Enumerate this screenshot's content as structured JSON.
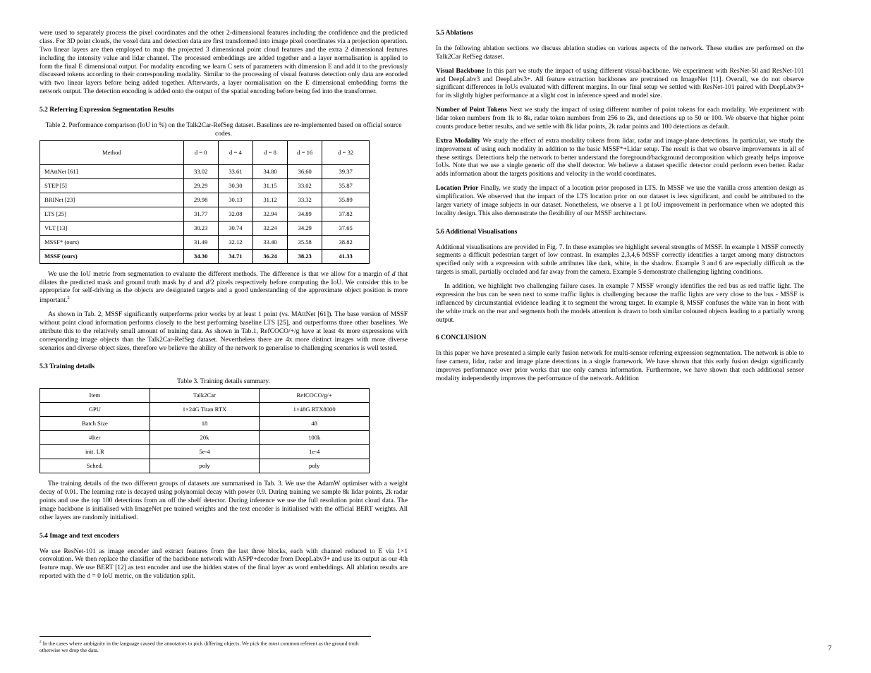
{
  "leftcol": {
    "para1": "were used to separately process the pixel coordinates and the other 2-dimensional features including the confidence and the predicted class. For 3D point clouds, the voxel data and detection data are first transformed into image pixel coordinates via a projection operation. Two linear layers are then employed to map the projected 3 dimensional point cloud features and the extra 2 dimensional features including the intensity value and lidar channel. The processed embeddings are added together and a layer normalisation is applied to form the final E dimensional output. For modality encoding we learn C sets of parameters with dimension E and add it to the previously discussed tokens according to their corresponding modality. Similar to the processing of visual features detection only data are encoded with two linear layers before being added together. Afterwards, a layer normalisation on the E dimensional embedding forms the network output. The detection encoding is added onto the output of the spatial encoding before being fed into the transformer.",
    "sectionRef": "5.2  Referring Expression Segmentation Results",
    "table2": {
      "caption": "Table 2. Performance comparison (IoU in %) on the Talk2Car-RefSeg dataset. Baselines are re-implemented based on official source codes.",
      "headers": [
        "Method",
        "d = 0",
        "d = 4",
        "d = 8",
        "d = 16",
        "d = 32"
      ],
      "rows": [
        {
          "label": "MAttNet [61]",
          "vals": [
            "33.02",
            "33.61",
            "34.80",
            "36.60",
            "39.37"
          ]
        },
        {
          "label": "STEP [5]",
          "vals": [
            "29.29",
            "30.30",
            "31.15",
            "33.02",
            "35.87"
          ]
        },
        {
          "label": "BRINet [23]",
          "vals": [
            "29.98",
            "30.13",
            "31.12",
            "33.32",
            "35.89"
          ]
        },
        {
          "label": "LTS [25]",
          "vals": [
            "31.77",
            "32.08",
            "32.94",
            "34.89",
            "37.82"
          ]
        },
        {
          "label": "VLT [13]",
          "vals": [
            "30.23",
            "30.74",
            "32.24",
            "34.29",
            "37.65"
          ]
        },
        {
          "label": "MSSF* (ours)",
          "vals": [
            "31.49",
            "32.12",
            "33.40",
            "35.58",
            "38.82"
          ]
        },
        {
          "label": "MSSF (ours)",
          "vals": [
            "34.30",
            "34.71",
            "36.24",
            "38.23",
            "41.33"
          ]
        }
      ]
    },
    "para2a": "We use the IoU metric from segmentation to evaluate the different methods. The difference is that we allow for a margin of ",
    "para2b": " that dilates the predicted mask and ground truth mask by ",
    "para2c": " and ",
    "para2d": " pixels respectively before computing the IoU. We consider this to be appropriate for self-driving as the objects are designated targets and a good understanding of the approximate object position is more important.",
    "para3": "As shown in Tab. 2, MSSF significantly outperforms prior works by at least 1 point (vs. MAttNet [61]). The base version of MSSF without point cloud information performs closely to the best performing baseline LTS [25], and outperforms three other baselines. We attribute this to the relatively small amount of training data. As shown in Tab.1, RefCOCO/+/g have at least 4x more expressions with corresponding image objects than the Talk2Car-RefSeg dataset. Nevertheless there are 4x more distinct images with more diverse scenarios and diverse object sizes, therefore we believe the ability of the network to generalise to challenging scenarios is well tested.",
    "sectionTraining": "5.3  Training details",
    "table3": {
      "caption": "Table 3. Training details summary.",
      "headers": [
        "Item",
        "Talk2Car",
        "RefCOCO/g/+"
      ],
      "rows": [
        {
          "c0": "GPU",
          "c1": "1×24G Titan RTX",
          "c2": "1×48G RTX8000"
        },
        {
          "c0": "Batch Size",
          "c1": "18",
          "c2": "48"
        },
        {
          "c0": "#Iter",
          "c1": "20k",
          "c2": "100k"
        },
        {
          "c0": "init. LR",
          "c1": "5e-4",
          "c2": "1e-4"
        },
        {
          "c0": "Sched.",
          "c1": "poly",
          "c2": "poly"
        }
      ]
    },
    "para4": "The training details of the two different groups of datasets are summarised in Tab. 3. We use the AdamW optimiser with a weight decay of 0.01. The learning rate is decayed using polynomial decay with power 0.9. During training we sample 8k lidar points, 2k radar points and use the top 100 detections from an off the shelf detector. During inference we use the full resolution point cloud data. The image backbone is initialised with ImageNet pre trained weights and the text encoder is initialised with the official BERT weights. All other layers are randomly initialised.",
    "sectionEncoders": "5.4  Image and text encoders",
    "para5": "We use ResNet-101 as image encoder and extract features from the last three blocks, each with channel reduced to E via 1×1 convolution. We then replace the classifier of the backbone network with ASPP+decoder from DeepLabv3+ and use its output as our 4th feature map. We use BERT [12] as text encoder and use the hidden states of the final layer as word embeddings. All ablation results are reported with the d = 0 IoU metric, on the validation split.",
    "footnote": {
      "marker": "2",
      "body": "In the cases where ambiguity in the language caused the annotators to pick differing objects. We pick the most common referent as the ground truth otherwise we drop the data."
    }
  },
  "rightcol": {
    "sectionAbl": "5.5  Ablations",
    "ablPara": "In the following ablation sections we discuss ablation studies on various aspects of the network. These studies are performed on the Talk2Car RefSeg dataset.",
    "ablBackboneTitle": "Visual Backbone",
    "ablBackboneBody": "  In this part we study the impact of using different visual-backbone. We experiment with ResNet-50 and ResNet-101 and DeepLabv3 and DeepLabv3+. All feature extraction backbones are pretrained on ImageNet [11]. Overall, we do not observe significant differences in IoUs evaluated with different margins. In our final setup we settled with ResNet-101 paired with DeepLabv3+ for its slightly higher performance at a slight cost in inference speed and model size.",
    "ablPointsTitle": "Number of Point Tokens",
    "ablPointsBody": "  Next we study the impact of using different number of point tokens for each modality. We experiment with lidar token numbers from 1k to 8k, radar token numbers from 256 to 2k, and detections up to 50 or 100. We observe that higher point counts produce better results, and we settle with 8k lidar points, 2k radar points and 100 detections as default.",
    "ablExtraTitle": "Extra Modality",
    "ablExtraBody": "  We study the effect of extra modality tokens from lidar, radar and image-plane detections. In particular, we study the improvement of using each modality in addition to the basic MSSF*+Lidar setup. The result is that we observe improvements in all of these settings. Detections help the network to better understand the foreground/background decomposition which greatly helps improve IoUs. Note that we use a single generic off the shelf detector. We believe a dataset specific detector could perform even better. Radar adds information about the targets positions and velocity in the world coordinates.",
    "ablLocTitle": "Location Prior",
    "ablLocBody": "  Finally, we study the impact of a location prior proposed in LTS. In MSSF we use the vanilla cross attention design as simplification. We observed that the impact of the LTS location prior on our dataset is less significant, and could be attributed to the larger variety of image subjects in our dataset. Nonetheless, we observe a 1 pt IoU improvement in performance when we adopted this locality design. This also demonstrate the flexibility of our MSSF architecture.",
    "sectionAddtlTitle": "5.6  Additional Visualisations",
    "addtl1": "Additional visualisations are provided in Fig. 7. In these examples we highlight several strengths of MSSF. In example 1 MSSF correctly segments a difficult pedestrian target of low contrast. In examples 2,3,4,6 MSSF correctly identifies a target among many distractors specified only with a expression with subtle attributes like dark, white, in the shadow. Example 3 and 6 are especially difficult as the targets is small, partially occluded and far away from the camera. Example 5 demonstrate challenging lighting conditions.",
    "addtl2": "In addition, we highlight two challenging failure cases. In example 7 MSSF wrongly identifies the red bus as red traffic light. The expression the bus can be seen next to some traffic lights is challenging because the traffic lights are very close to the bus - MSSF is influenced by circumstantial evidence leading it to segment the wrong target. In example 8, MSSF confuses the white van in front with the white truck on the rear and segments both the models attention is drawn to both similar coloured objects leading to a partially wrong output.",
    "sectionConcl": "6  CONCLUSION",
    "concl": "In this paper we have presented a simple early fusion network for multi-sensor referring expression segmentation. The network is able to fuse camera, lidar, radar and image plane detections in a single framework. We have shown that this early fusion design significantly improves performance over prior works that use only camera information. Furthermore, we have shown that each additional sensor modality independently improves the performance of the network. Addition"
  },
  "pageNumber": "7"
}
